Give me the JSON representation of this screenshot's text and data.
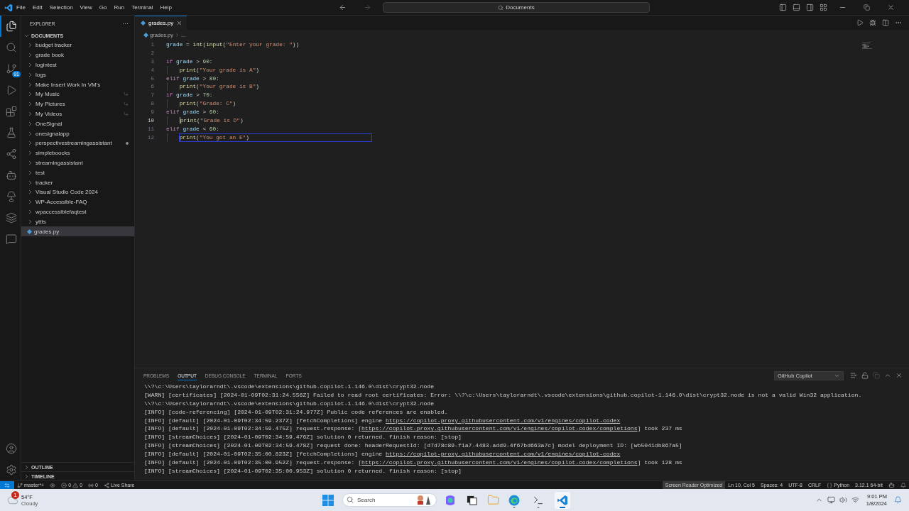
{
  "title_bar": {
    "menu": [
      "File",
      "Edit",
      "Selection",
      "View",
      "Go",
      "Run",
      "Terminal",
      "Help"
    ],
    "command_center": "Documents"
  },
  "activity_bar": {
    "items": [
      {
        "selected": true
      },
      {
        "selected": false
      },
      {
        "selected": false,
        "badge": "91"
      },
      {
        "selected": false
      },
      {
        "selected": false
      },
      {
        "selected": false
      },
      {
        "selected": false
      },
      {
        "selected": false
      },
      {
        "selected": false
      },
      {
        "selected": false
      },
      {
        "selected": false
      }
    ]
  },
  "sidebar": {
    "title": "EXPLORER",
    "more": "···",
    "folder": "DOCUMENTS",
    "items": [
      {
        "kind": "folder",
        "label": "budget tracker",
        "selected": false,
        "linked": false,
        "modified": false
      },
      {
        "kind": "folder",
        "label": "grade book",
        "selected": false,
        "linked": false,
        "modified": false
      },
      {
        "kind": "folder",
        "label": "logintest",
        "selected": false,
        "linked": false,
        "modified": false
      },
      {
        "kind": "folder",
        "label": "logs",
        "selected": false,
        "linked": false,
        "modified": false
      },
      {
        "kind": "folder",
        "label": "Make Insert Work In VM's",
        "selected": false,
        "linked": false,
        "modified": false
      },
      {
        "kind": "folder",
        "label": "My Music",
        "selected": false,
        "linked": true,
        "modified": false
      },
      {
        "kind": "folder",
        "label": "My Pictures",
        "selected": false,
        "linked": true,
        "modified": false
      },
      {
        "kind": "folder",
        "label": "My Videos",
        "selected": false,
        "linked": true,
        "modified": false
      },
      {
        "kind": "folder",
        "label": "OneSignal",
        "selected": false,
        "linked": false,
        "modified": false
      },
      {
        "kind": "folder",
        "label": "onesignalapp",
        "selected": false,
        "linked": false,
        "modified": false
      },
      {
        "kind": "folder",
        "label": "perspectivestreamingassistant",
        "selected": false,
        "linked": false,
        "modified": true
      },
      {
        "kind": "folder",
        "label": "simpleboocks",
        "selected": false,
        "linked": false,
        "modified": false
      },
      {
        "kind": "folder",
        "label": "streamingassistant",
        "selected": false,
        "linked": false,
        "modified": false
      },
      {
        "kind": "folder",
        "label": "test",
        "selected": false,
        "linked": false,
        "modified": false
      },
      {
        "kind": "folder",
        "label": "tracker",
        "selected": false,
        "linked": false,
        "modified": false
      },
      {
        "kind": "folder",
        "label": "Visual Studio Code 2024",
        "selected": false,
        "linked": false,
        "modified": false
      },
      {
        "kind": "folder",
        "label": "WP-Accessible-FAQ",
        "selected": false,
        "linked": false,
        "modified": false
      },
      {
        "kind": "folder",
        "label": "wpaccessiblefaqtest",
        "selected": false,
        "linked": false,
        "modified": false
      },
      {
        "kind": "folder",
        "label": "yttts",
        "selected": false,
        "linked": false,
        "modified": false
      },
      {
        "kind": "file",
        "label": "grades.py",
        "selected": true,
        "linked": false,
        "modified": false
      }
    ],
    "sections": [
      "OUTLINE",
      "TIMELINE"
    ]
  },
  "editor": {
    "tabs": [
      {
        "label": "grades.py",
        "selected": true
      }
    ],
    "breadcrumbs": [
      "grades.py",
      "..."
    ],
    "lines": [
      {
        "number": "1",
        "current": false,
        "outlined": false,
        "indented": false,
        "tokens": [
          {
            "text": "grade",
            "kind": "var"
          },
          {
            "text": " = ",
            "kind": "plain"
          },
          {
            "text": "int",
            "kind": "fn"
          },
          {
            "text": "(",
            "kind": "plain"
          },
          {
            "text": "input",
            "kind": "fn"
          },
          {
            "text": "(",
            "kind": "plain"
          },
          {
            "text": "\"Enter your grade: \"",
            "kind": "str"
          },
          {
            "text": "))",
            "kind": "plain"
          }
        ]
      },
      {
        "number": "2",
        "current": false
      },
      {
        "number": "3",
        "current": false,
        "outlined": false,
        "indented": false,
        "tokens": [
          {
            "text": "if ",
            "kind": "kw"
          },
          {
            "text": "grade",
            "kind": "var"
          },
          {
            "text": " > ",
            "kind": "plain"
          },
          {
            "text": "90",
            "kind": "num"
          },
          {
            "text": ":",
            "kind": "plain"
          }
        ]
      },
      {
        "number": "4",
        "current": false,
        "outlined": false,
        "indented": true,
        "tokens": [
          {
            "text": "print",
            "kind": "fn"
          },
          {
            "text": "(",
            "kind": "plain"
          },
          {
            "text": "\"Your grade is A\"",
            "kind": "str"
          },
          {
            "text": ")",
            "kind": "plain"
          }
        ]
      },
      {
        "number": "5",
        "current": false,
        "outlined": false,
        "indented": false,
        "tokens": [
          {
            "text": "elif ",
            "kind": "kw"
          },
          {
            "text": "grade",
            "kind": "var"
          },
          {
            "text": " > ",
            "kind": "plain"
          },
          {
            "text": "80",
            "kind": "num"
          },
          {
            "text": ":",
            "kind": "plain"
          }
        ]
      },
      {
        "number": "6",
        "current": false,
        "outlined": false,
        "indented": true,
        "tokens": [
          {
            "text": "print",
            "kind": "fn"
          },
          {
            "text": "(",
            "kind": "plain"
          },
          {
            "text": "\"Your grade is B\"",
            "kind": "str"
          },
          {
            "text": ")",
            "kind": "plain"
          }
        ]
      },
      {
        "number": "7",
        "current": false,
        "outlined": false,
        "indented": false,
        "tokens": [
          {
            "text": "if ",
            "kind": "kw"
          },
          {
            "text": "grade",
            "kind": "var"
          },
          {
            "text": " > ",
            "kind": "plain"
          },
          {
            "text": "70",
            "kind": "num"
          },
          {
            "text": ":",
            "kind": "plain"
          }
        ]
      },
      {
        "number": "8",
        "current": false,
        "outlined": false,
        "indented": true,
        "tokens": [
          {
            "text": "print",
            "kind": "fn"
          },
          {
            "text": "(",
            "kind": "plain"
          },
          {
            "text": "\"Grade: C\"",
            "kind": "str"
          },
          {
            "text": ")",
            "kind": "plain"
          }
        ]
      },
      {
        "number": "9",
        "current": false,
        "outlined": false,
        "indented": false,
        "tokens": [
          {
            "text": "elif ",
            "kind": "kw"
          },
          {
            "text": "grade",
            "kind": "var"
          },
          {
            "text": " > ",
            "kind": "plain"
          },
          {
            "text": "60",
            "kind": "num"
          },
          {
            "text": ":",
            "kind": "plain"
          }
        ]
      },
      {
        "number": "10",
        "current": true,
        "outlined": false,
        "indented": true,
        "tokens": [
          {
            "text": "print",
            "kind": "fn"
          },
          {
            "text": "(",
            "kind": "plain"
          },
          {
            "text": "\"Grade is D\"",
            "kind": "str"
          },
          {
            "text": ")",
            "kind": "plain"
          }
        ]
      },
      {
        "number": "11",
        "current": false,
        "outlined": false,
        "indented": false,
        "tokens": [
          {
            "text": "elif ",
            "kind": "kw"
          },
          {
            "text": "grade",
            "kind": "var"
          },
          {
            "text": " < ",
            "kind": "plain"
          },
          {
            "text": "60",
            "kind": "num"
          },
          {
            "text": ":",
            "kind": "plain"
          }
        ]
      },
      {
        "number": "12",
        "current": false,
        "outlined": true,
        "indented": true,
        "tokens": [
          {
            "text": "print",
            "kind": "fn"
          },
          {
            "text": "(",
            "kind": "plain"
          },
          {
            "text": "\"You got an E\"",
            "kind": "str"
          },
          {
            "text": ")",
            "kind": "plain"
          }
        ]
      }
    ]
  },
  "panel": {
    "tabs": [
      {
        "label": "PROBLEMS",
        "selected": false
      },
      {
        "label": "OUTPUT",
        "selected": true
      },
      {
        "label": "DEBUG CONSOLE",
        "selected": false
      },
      {
        "label": "TERMINAL",
        "selected": false
      },
      {
        "label": "PORTS",
        "selected": false
      }
    ],
    "channel": "GitHub Copilot",
    "output": [
      {
        "parts": [
          {
            "text": "\\\\?\\c:\\Users\\taylorarndt\\.vscode\\extensions\\github.copilot-1.146.0\\dist\\crypt32.node",
            "kind": "text"
          }
        ]
      },
      {
        "parts": [
          {
            "text": "[WARN] [certificates] [2024-01-09T02:31:24.556Z] Failed to read root certificates: Error: \\\\?\\c:\\Users\\taylorarndt\\.vscode\\extensions\\github.copilot-1.146.0\\dist\\crypt32.node is not a valid Win32 application.",
            "kind": "text"
          }
        ]
      },
      {
        "parts": [
          {
            "text": "\\\\?\\c:\\Users\\taylorarndt\\.vscode\\extensions\\github.copilot-1.146.0\\dist\\crypt32.node",
            "kind": "text"
          }
        ]
      },
      {
        "parts": [
          {
            "text": "[INFO] [code-referencing] [2024-01-09T02:31:24.977Z] Public code references are enabled.",
            "kind": "text"
          }
        ]
      },
      {
        "parts": [
          {
            "text": "[INFO] [default] [2024-01-09T02:34:59.237Z] [fetchCompletions] engine ",
            "kind": "text"
          },
          {
            "text": "https://copilot-proxy.githubusercontent.com/v1/engines/copilot-codex",
            "kind": "link"
          }
        ]
      },
      {
        "parts": [
          {
            "text": "[INFO] [default] [2024-01-09T02:34:59.475Z] request.response: [",
            "kind": "text"
          },
          {
            "text": "https://copilot-proxy.githubusercontent.com/v1/engines/copilot-codex/completions",
            "kind": "link"
          },
          {
            "text": "] took 237 ms",
            "kind": "text"
          }
        ]
      },
      {
        "parts": [
          {
            "text": "[INFO] [streamChoices] [2024-01-09T02:34:59.476Z] solution 0 returned. finish reason: [stop]",
            "kind": "text"
          }
        ]
      },
      {
        "parts": [
          {
            "text": "[INFO] [streamChoices] [2024-01-09T02:34:59.478Z] request done: headerRequestId: [d7d78c89-f1a7-4483-add9-4f67bd663a7c] model deployment ID: [wb5041db867a5]",
            "kind": "text"
          }
        ]
      },
      {
        "parts": [
          {
            "text": "[INFO] [default] [2024-01-09T02:35:00.823Z] [fetchCompletions] engine ",
            "kind": "text"
          },
          {
            "text": "https://copilot-proxy.githubusercontent.com/v1/engines/copilot-codex",
            "kind": "link"
          }
        ]
      },
      {
        "parts": [
          {
            "text": "[INFO] [default] [2024-01-09T02:35:00.952Z] request.response: [",
            "kind": "text"
          },
          {
            "text": "https://copilot-proxy.githubusercontent.com/v1/engines/copilot-codex/completions",
            "kind": "link"
          },
          {
            "text": "] took 128 ms",
            "kind": "text"
          }
        ]
      },
      {
        "parts": [
          {
            "text": "[INFO] [streamChoices] [2024-01-09T02:35:00.953Z] solution 0 returned. finish reason: [stop]",
            "kind": "text"
          }
        ]
      }
    ]
  },
  "status_bar": {
    "left": [
      {
        "kind": "remote"
      },
      {
        "kind": "branch",
        "text": "master*+"
      },
      {
        "kind": "eye"
      },
      {
        "kind": "problems",
        "errors": "0",
        "warnings": "0"
      },
      {
        "kind": "ports",
        "text": "0"
      },
      {
        "kind": "liveshare",
        "text": "Live Share"
      }
    ],
    "right": [
      {
        "kind": "plain",
        "text": "Screen Reader Optimized",
        "highlighted": true
      },
      {
        "kind": "plain",
        "text": "Ln 10, Col 5",
        "highlighted": false
      },
      {
        "kind": "plain",
        "text": "Spaces: 4",
        "highlighted": false
      },
      {
        "kind": "plain",
        "text": "UTF-8",
        "highlighted": false
      },
      {
        "kind": "plain",
        "text": "CRLF",
        "highlighted": false
      },
      {
        "kind": "language",
        "text": "Python"
      },
      {
        "kind": "plain",
        "text": "3.12.1 64-bit",
        "highlighted": false
      },
      {
        "kind": "copilot"
      },
      {
        "kind": "bell"
      }
    ]
  },
  "taskbar": {
    "weather": {
      "badge": "1",
      "temperature": "54°F",
      "condition": "Cloudy"
    },
    "search": {
      "placeholder": "Search"
    },
    "apps": [
      {
        "running": false,
        "active": false
      },
      {
        "running": false,
        "active": false
      },
      {
        "running": false,
        "active": false
      },
      {
        "running": true,
        "active": false
      },
      {
        "running": true,
        "active": false
      },
      {
        "running": true,
        "active": true
      }
    ],
    "time": "9:01 PM",
    "date": "1/8/2024"
  }
}
